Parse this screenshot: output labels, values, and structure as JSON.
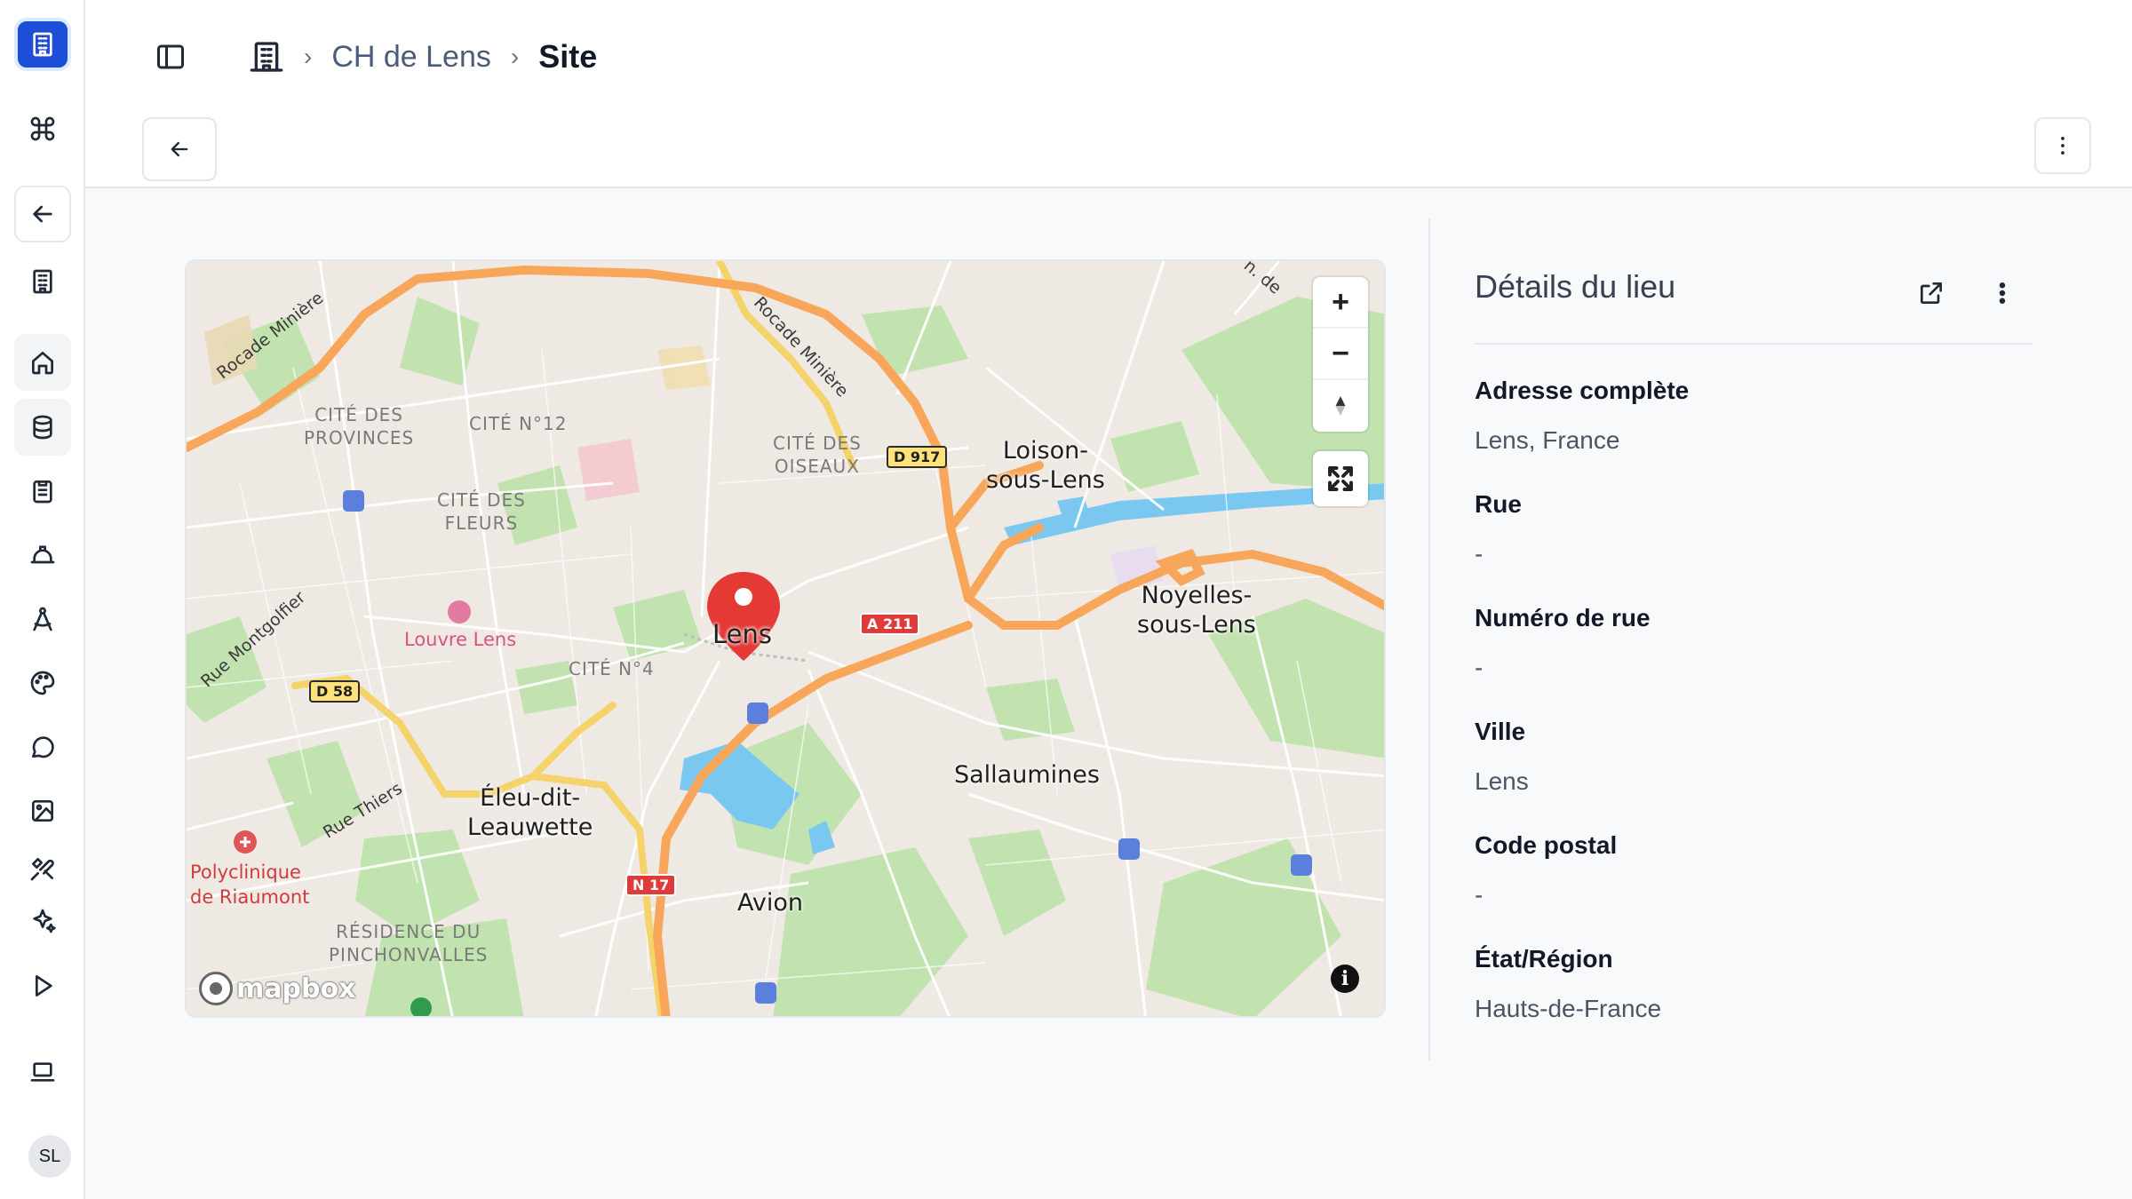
{
  "rail": {
    "items": [
      {
        "name": "command-icon"
      },
      {
        "name": "back-arrow-icon"
      },
      {
        "name": "building-icon"
      },
      {
        "name": "home-icon"
      },
      {
        "name": "database-icon"
      },
      {
        "name": "clipboard-icon"
      },
      {
        "name": "hard-hat-icon"
      },
      {
        "name": "drafting-compass-icon"
      },
      {
        "name": "palette-icon"
      },
      {
        "name": "chat-icon"
      },
      {
        "name": "image-icon"
      },
      {
        "name": "tools-icon"
      },
      {
        "name": "sparkles-icon"
      },
      {
        "name": "play-icon"
      },
      {
        "name": "laptop-icon"
      }
    ],
    "avatar_initials": "SL"
  },
  "header": {
    "breadcrumb": {
      "parent": "CH de Lens",
      "current": "Site"
    }
  },
  "map": {
    "cities": {
      "loison": "Loison-\nsous-Lens",
      "noyelles": "Noyelles-\nsous-Lens",
      "lens": "Lens",
      "sallaumines": "Sallaumines",
      "eleu": "Éleu-dit-\nLeauwette",
      "avion": "Avion"
    },
    "districts": {
      "provinces": "CITÉ DES\nPROVINCES",
      "n12": "CITÉ N°12",
      "oiseaux": "CITÉ DES\nOISEAUX",
      "fleurs": "CITÉ DES\nFLEURS",
      "n4": "CITÉ N°4",
      "pinchonvalles": "RÉSIDENCE DU\nPINCHONVALLES"
    },
    "pois": {
      "louvre": "Louvre Lens",
      "polyclinique": "Polyclinique\nde Riaumont"
    },
    "roads": {
      "rocade_west": "Rocade Minière",
      "rocade_north": "Rocade Minière",
      "montgolfier": "Rue Montgolfier",
      "thiers": "Rue Thiers",
      "edge": "n. de"
    },
    "shields": {
      "d917": "D 917",
      "a211": "A 211",
      "d58": "D 58",
      "n17": "N 17"
    },
    "controls": {
      "zoom_in": "+",
      "zoom_out": "−",
      "info": "i"
    },
    "attribution_logo": "mapbox",
    "colors": {
      "motorway": "#f7a65a",
      "primary_road": "#f6d86e",
      "water": "#7ac7f0",
      "park": "#b8dfa5",
      "marker": "#e53935"
    }
  },
  "details": {
    "title": "Détails du lieu",
    "fields": [
      {
        "label": "Adresse complète",
        "value": "Lens, France"
      },
      {
        "label": "Rue",
        "value": "-"
      },
      {
        "label": "Numéro de rue",
        "value": "-"
      },
      {
        "label": "Ville",
        "value": "Lens"
      },
      {
        "label": "Code postal",
        "value": "-"
      },
      {
        "label": "État/Région",
        "value": "Hauts-de-France"
      }
    ]
  }
}
